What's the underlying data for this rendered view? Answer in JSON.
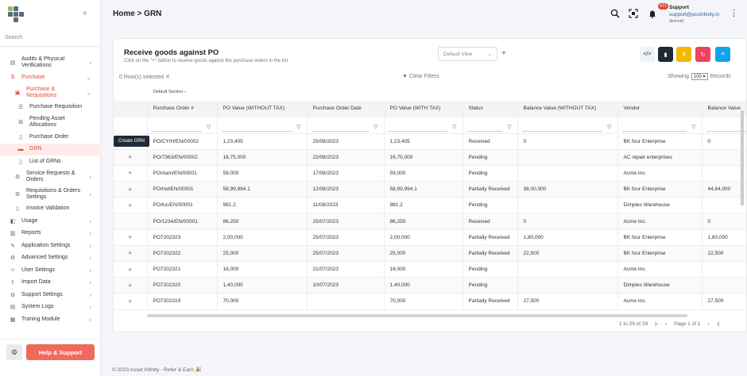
{
  "sidebar": {
    "search_placeholder": "Search",
    "items": [
      {
        "label": "Audits & Physical Verifications",
        "icon": "audit-icon"
      },
      {
        "label": "Purchase",
        "icon": "dollar-icon"
      },
      {
        "label": "Purchase & Requisitions",
        "icon": "cart-icon"
      },
      {
        "label": "Purchase Requisition",
        "icon": "list-icon"
      },
      {
        "label": "Pending Asset Allocations",
        "icon": "hierarchy-icon"
      },
      {
        "label": "Purchase Order",
        "icon": "document-icon"
      },
      {
        "label": "GRN",
        "icon": "grn-icon"
      },
      {
        "label": "List of GRNs",
        "icon": "document-icon"
      },
      {
        "label": "Service Requests & Orders",
        "icon": "service-icon"
      },
      {
        "label": "Requisitions & Orders Settings",
        "icon": "settings-icon"
      },
      {
        "label": "Invoice Validation",
        "icon": "invoice-icon"
      },
      {
        "label": "Usage",
        "icon": "usage-icon"
      },
      {
        "label": "Reports",
        "icon": "reports-icon"
      },
      {
        "label": "Application Settings",
        "icon": "wrench-icon"
      },
      {
        "label": "Advanced Settings",
        "icon": "gears-icon"
      },
      {
        "label": "User Settings",
        "icon": "user-settings-icon"
      },
      {
        "label": "Import Data",
        "icon": "import-icon"
      },
      {
        "label": "Support Settings",
        "icon": "support-icon"
      },
      {
        "label": "System Logs",
        "icon": "logs-icon"
      },
      {
        "label": "Traning Module",
        "icon": "training-icon"
      }
    ],
    "help_label": "Help & Support"
  },
  "header": {
    "title": "Home > GRN",
    "notification_count": "471",
    "user_name": "Support",
    "user_email": "support@pcsinfinity.in",
    "user_role": "demoid"
  },
  "card": {
    "title": "Receive goods against PO",
    "subtitle": "Click on the \"+\" button to receive goods against the purchase orders in the list",
    "view_select": "Default View",
    "rows_selected": "0 Row(s) selected",
    "clear_filters": "Clear Filters",
    "showing_label": "Showing",
    "page_size": "100",
    "records_label": "Records",
    "default_section": "Default Section",
    "tooltip": "Create GRN",
    "pager_range": "1 to 29 of 29",
    "pager_page": "Page 1 of 1"
  },
  "table": {
    "columns": [
      "Purchase Order #",
      "PO Value (WITHOUT TAX)",
      "Purchase Order Date",
      "PO Value (WITH TAX)",
      "Status",
      "Balance Value (WITHOUT TAX)",
      "Vendor",
      "Balance Value"
    ],
    "rows": [
      {
        "plus": "",
        "cells": [
          "PO/CYIH/EN/00002",
          "1,23,405",
          "29/08/2023",
          "1,23,405",
          "Received",
          "0",
          "BK four Enterprise",
          "0"
        ]
      },
      {
        "plus": "+",
        "cells": [
          "PO/7363/EN/00002",
          "16,75,000",
          "22/08/2023",
          "16,75,000",
          "Pending",
          "",
          "AC repair enterprises",
          ""
        ]
      },
      {
        "plus": "+",
        "cells": [
          "PO/Aam/EN/00001",
          "59,000",
          "17/08/2023",
          "59,000",
          "Pending",
          "",
          "Acme Inc.",
          ""
        ]
      },
      {
        "plus": "+",
        "cells": [
          "PO/Ind/EN/00001",
          "58,99,994.1",
          "12/08/2023",
          "58,99,994.1",
          "Partially Received",
          "38,00,000",
          "BK four Enterprise",
          "44,84,000"
        ]
      },
      {
        "plus": "+",
        "cells": [
          "PO/luc/EN/00001",
          "981.2",
          "11/08/2023",
          "981.2",
          "Pending",
          "",
          "Dimples Warehouse",
          ""
        ]
      },
      {
        "plus": "",
        "cells": [
          "PO/1234/EN/00001",
          "86,250",
          "25/07/2023",
          "86,250",
          "Received",
          "0",
          "Acme Inc.",
          "0"
        ]
      },
      {
        "plus": "+",
        "cells": [
          "PO7202323",
          "2,00,000",
          "25/07/2023",
          "2,00,000",
          "Partially Received",
          "1,80,000",
          "BK four Enterprise",
          "1,80,000"
        ]
      },
      {
        "plus": "+",
        "cells": [
          "PO7202322",
          "25,000",
          "25/07/2023",
          "25,000",
          "Partially Received",
          "22,500",
          "BK four Enterprise",
          "22,500"
        ]
      },
      {
        "plus": "+",
        "cells": [
          "PO7202321",
          "16,000",
          "21/07/2023",
          "16,000",
          "Pending",
          "",
          "Acme Inc.",
          ""
        ]
      },
      {
        "plus": "+",
        "cells": [
          "PO7202320",
          "1,40,000",
          "10/07/2023",
          "1,40,000",
          "Pending",
          "",
          "Dimples Warehouse",
          ""
        ]
      },
      {
        "plus": "+",
        "cells": [
          "PO7202319",
          "70,000",
          "",
          "70,000",
          "Partially Received",
          "27,500",
          "Acme Inc.",
          "27,500"
        ]
      }
    ]
  },
  "footer": {
    "text": "© 2023 Asset Infinity - Refer & Earn"
  },
  "colors": {
    "accent": "#e0483a",
    "help": "#ef6a5a",
    "dark": "#1f2937",
    "yellow": "#f5b800",
    "pink": "#f43f5e",
    "blue": "#0ea5e9"
  }
}
